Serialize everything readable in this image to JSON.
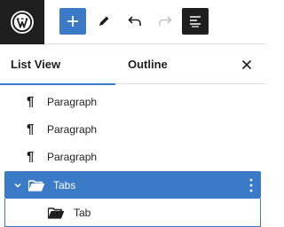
{
  "toolbar": {
    "logo_icon": "wordpress-logo",
    "add_icon": "plus-icon",
    "tools_icon": "pencil-icon",
    "undo_icon": "undo-icon",
    "redo_icon": "redo-icon",
    "list_view_icon": "list-view-icon",
    "accent_color": "#3a7ac6"
  },
  "panel": {
    "tabs": [
      {
        "label": "List View",
        "active": true
      },
      {
        "label": "Outline",
        "active": false
      }
    ],
    "close_icon": "close-icon"
  },
  "list": {
    "items": [
      {
        "label": "Paragraph",
        "icon": "paragraph-icon"
      },
      {
        "label": "Paragraph",
        "icon": "paragraph-icon"
      },
      {
        "label": "Paragraph",
        "icon": "paragraph-icon"
      },
      {
        "label": "Tabs",
        "icon": "folder-icon",
        "expanded": true,
        "selected": true
      },
      {
        "label": "Tab",
        "icon": "folder-icon",
        "child_of": "Tabs"
      }
    ]
  }
}
